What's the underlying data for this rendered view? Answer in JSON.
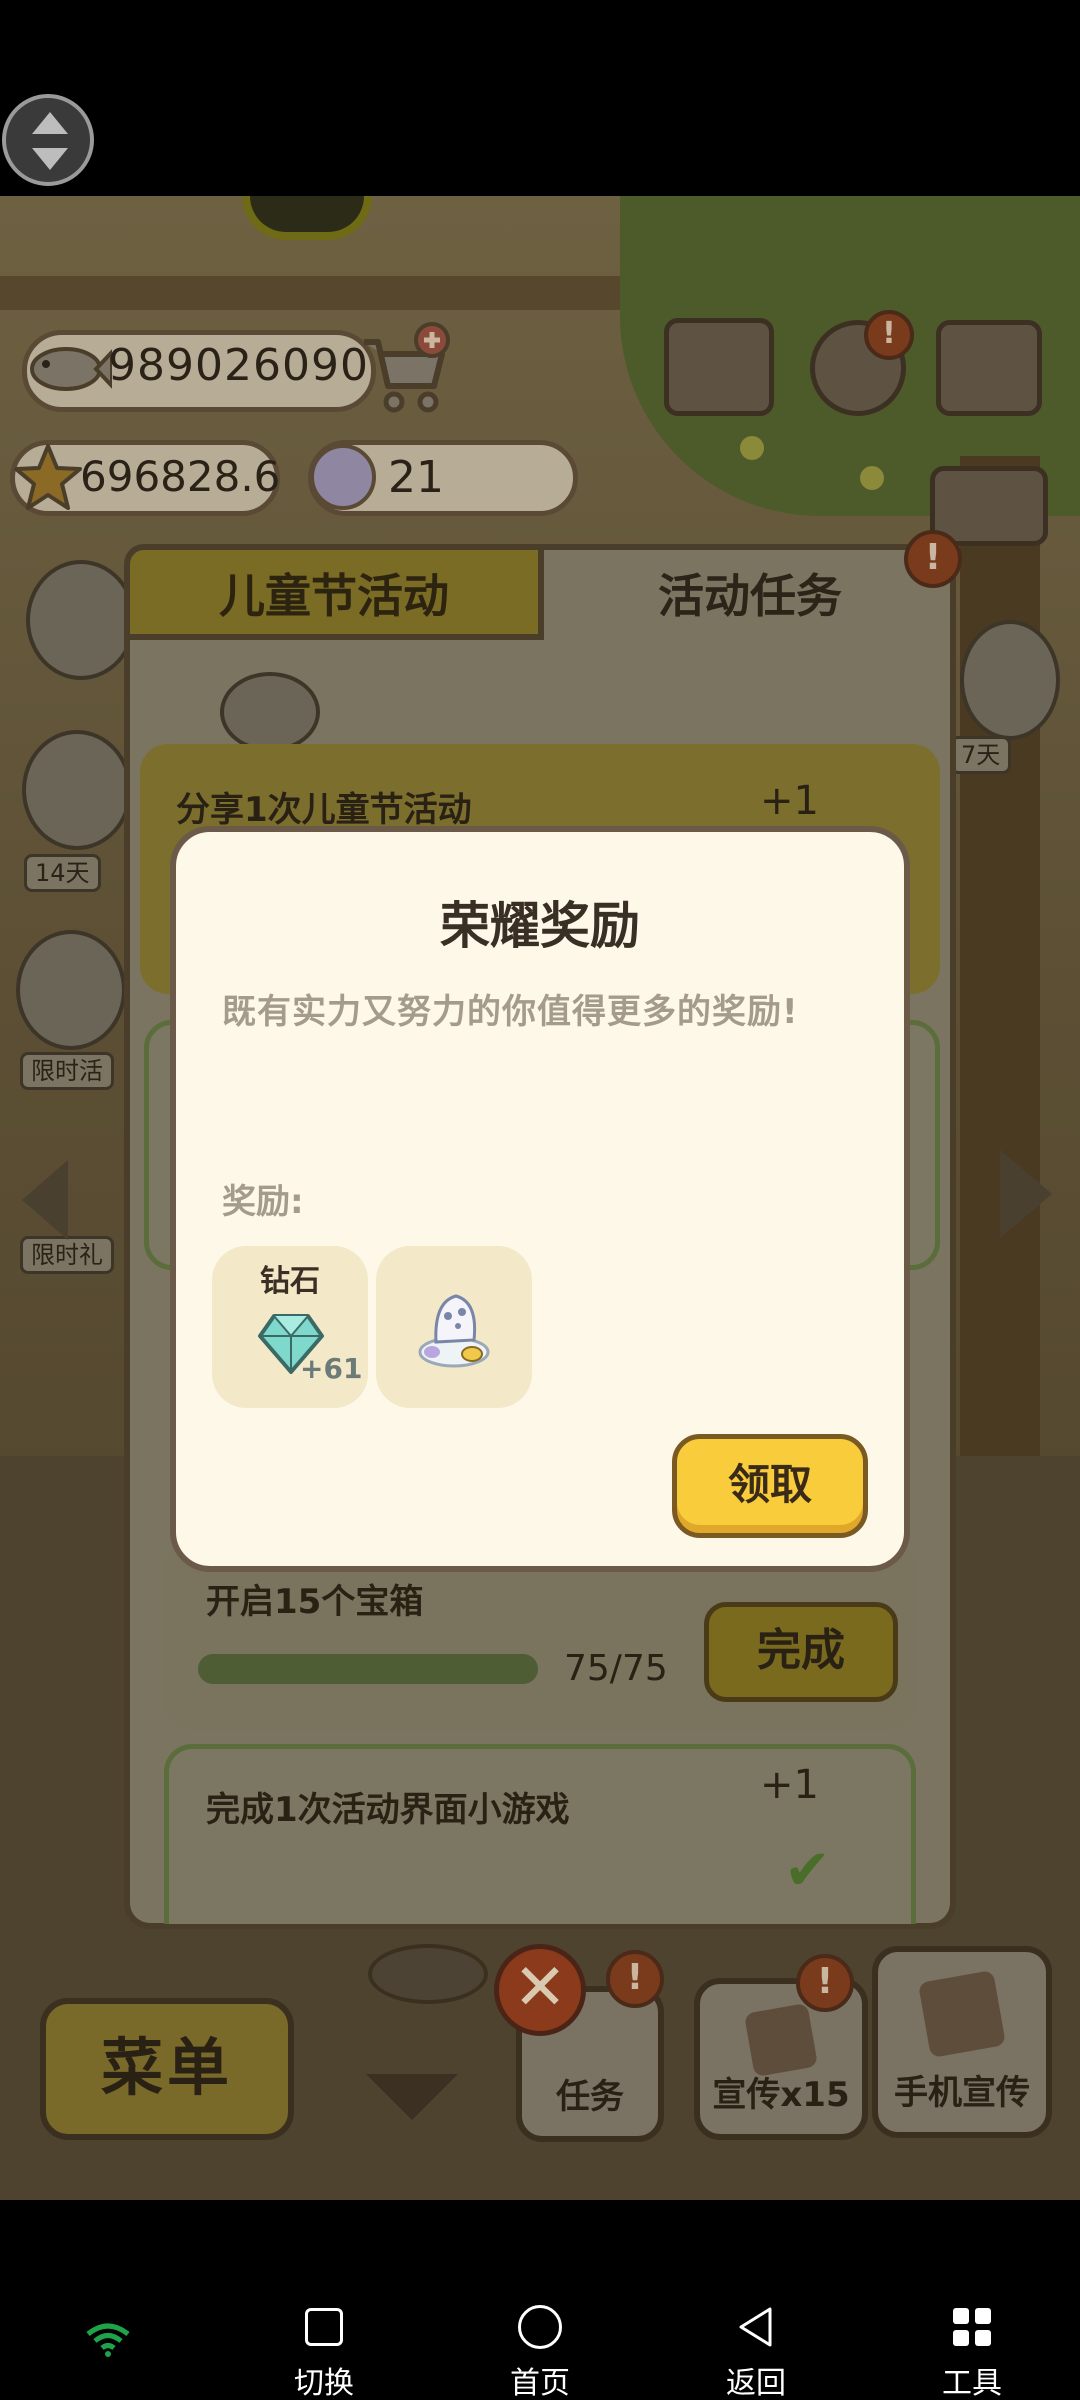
{
  "resources": {
    "fish": "989026090",
    "star": "696828.6",
    "paw": "21"
  },
  "scene": {
    "side_tags": {
      "days_14": "14天",
      "days_7": "7天",
      "limited_event": "限时活",
      "limited_gift": "限时礼"
    }
  },
  "panel": {
    "tab_active": "儿童节活动",
    "tab_inactive": "活动任务",
    "tasks": [
      {
        "title": "分享1次儿童节活动",
        "reward": "+1"
      },
      {
        "title": "开启15个宝箱",
        "progress": "75/75",
        "button": "完成",
        "progress_fraction": 1.0
      },
      {
        "title": "完成1次活动界面小游戏",
        "reward": "+1"
      }
    ]
  },
  "modal": {
    "title": "荣耀奖励",
    "subtitle": "既有实力又努力的你值得更多的奖励!",
    "reward_label": "奖励:",
    "rewards": [
      {
        "name": "钻石",
        "count": "+61",
        "icon": "diamond-icon"
      },
      {
        "icon": "costume-icon"
      }
    ],
    "claim_button": "领取"
  },
  "bottom_bar": {
    "menu": "菜单",
    "tasks": "任务",
    "promo": "宣传x15",
    "phone_promo": "手机宣传"
  },
  "android_nav": {
    "switch": "切换",
    "home": "首页",
    "back": "返回",
    "tools": "工具"
  },
  "colors": {
    "accent_yellow": "#f9cc3b",
    "modal_bg": "#fdf8e8",
    "wifi_green": "#1fa34a"
  }
}
